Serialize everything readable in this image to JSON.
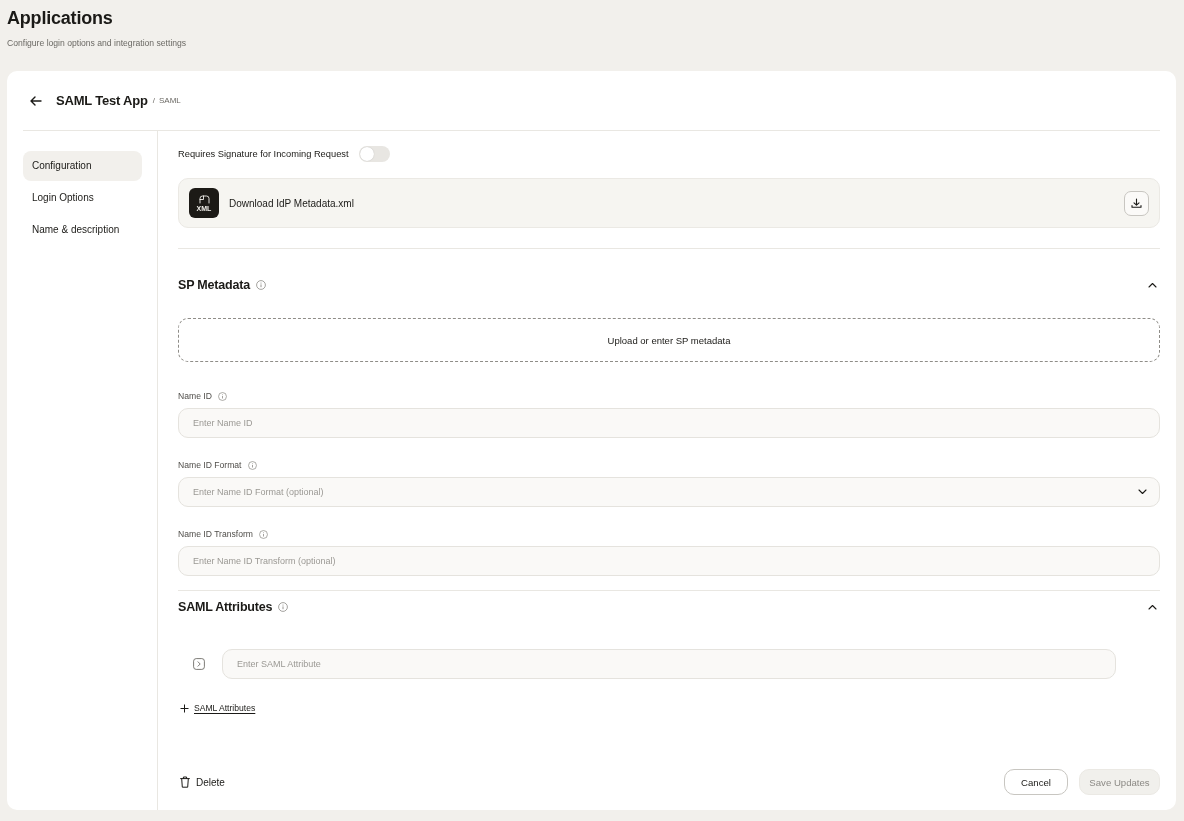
{
  "page": {
    "title": "Applications",
    "subtitle": "Configure login options and integration settings"
  },
  "app_header": {
    "title": "SAML Test App",
    "separator": "/",
    "protocol": "SAML"
  },
  "sidebar": {
    "items": [
      {
        "label": "Configuration",
        "selected": true
      },
      {
        "label": "Login Options",
        "selected": false
      },
      {
        "label": "Name & description",
        "selected": false
      }
    ]
  },
  "signature_toggle": {
    "label": "Requires Signature for Incoming Request",
    "on": false
  },
  "download": {
    "label": "Download IdP Metadata.xml",
    "file_type": "XML"
  },
  "sp_metadata": {
    "title": "SP Metadata",
    "expanded": true,
    "dropzone": "Upload or enter SP metadata",
    "fields": [
      {
        "kind": "text",
        "label": "Name ID",
        "placeholder": "Enter Name ID"
      },
      {
        "kind": "select",
        "label": "Name ID Format",
        "placeholder": "Enter Name ID Format (optional)"
      },
      {
        "kind": "text",
        "label": "Name ID Transform",
        "placeholder": "Enter Name ID Transform (optional)"
      }
    ]
  },
  "saml_attributes": {
    "title": "SAML Attributes",
    "expanded": true,
    "rows": [
      {
        "placeholder": "Enter SAML Attribute"
      }
    ],
    "add_link": "SAML Attributes"
  },
  "footer": {
    "delete": "Delete",
    "cancel": "Cancel",
    "save": {
      "label": "Save Updates",
      "disabled": true
    }
  }
}
